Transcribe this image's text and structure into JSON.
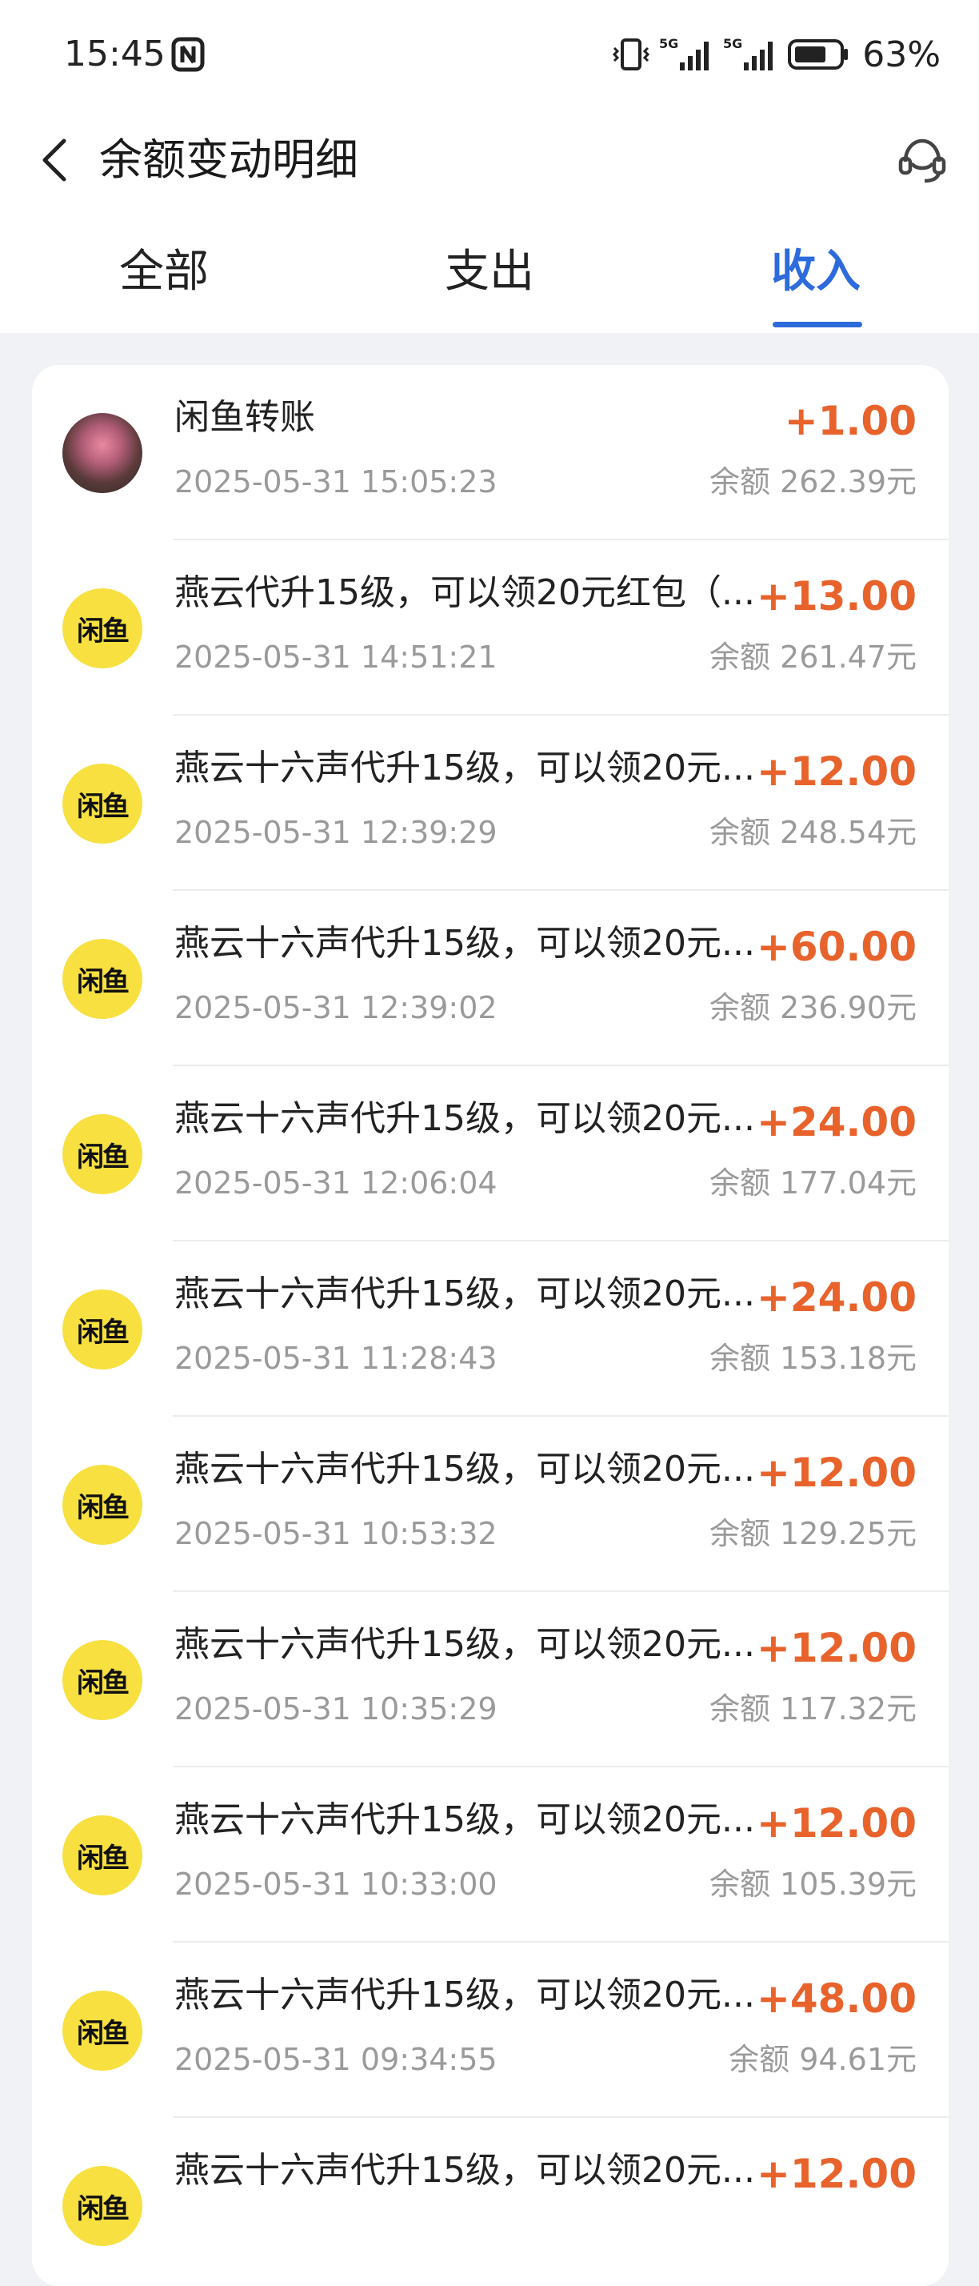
{
  "status": {
    "time": "15:45",
    "signal1": "5G",
    "signal2": "5G",
    "battery": "63%"
  },
  "header": {
    "title": "余额变动明细"
  },
  "tabs": [
    {
      "label": "全部"
    },
    {
      "label": "支出"
    },
    {
      "label": "收入"
    }
  ],
  "active_tab": "收入",
  "colors": {
    "accent": "#2d6bdc",
    "income": "#e8632c",
    "logo_bg": "#f7e040"
  },
  "transactions": [
    {
      "title": "闲鱼转账",
      "time": "2025-05-31 15:05:23",
      "amount": "+1.00",
      "balance": "余额 262.39元",
      "icon": "photo-avatar"
    },
    {
      "title": "燕云代升15级，可以领20元红包（...",
      "time": "2025-05-31 14:51:21",
      "amount": "+13.00",
      "balance": "余额 261.47元",
      "icon": "xianyu-logo",
      "logo": "闲鱼"
    },
    {
      "title": "燕云十六声代升15级，可以领20元...",
      "time": "2025-05-31 12:39:29",
      "amount": "+12.00",
      "balance": "余额 248.54元",
      "icon": "xianyu-logo",
      "logo": "闲鱼"
    },
    {
      "title": "燕云十六声代升15级，可以领20元...",
      "time": "2025-05-31 12:39:02",
      "amount": "+60.00",
      "balance": "余额 236.90元",
      "icon": "xianyu-logo",
      "logo": "闲鱼"
    },
    {
      "title": "燕云十六声代升15级，可以领20元...",
      "time": "2025-05-31 12:06:04",
      "amount": "+24.00",
      "balance": "余额 177.04元",
      "icon": "xianyu-logo",
      "logo": "闲鱼"
    },
    {
      "title": "燕云十六声代升15级，可以领20元...",
      "time": "2025-05-31 11:28:43",
      "amount": "+24.00",
      "balance": "余额 153.18元",
      "icon": "xianyu-logo",
      "logo": "闲鱼"
    },
    {
      "title": "燕云十六声代升15级，可以领20元...",
      "time": "2025-05-31 10:53:32",
      "amount": "+12.00",
      "balance": "余额 129.25元",
      "icon": "xianyu-logo",
      "logo": "闲鱼"
    },
    {
      "title": "燕云十六声代升15级，可以领20元...",
      "time": "2025-05-31 10:35:29",
      "amount": "+12.00",
      "balance": "余额 117.32元",
      "icon": "xianyu-logo",
      "logo": "闲鱼"
    },
    {
      "title": "燕云十六声代升15级，可以领20元...",
      "time": "2025-05-31 10:33:00",
      "amount": "+12.00",
      "balance": "余额 105.39元",
      "icon": "xianyu-logo",
      "logo": "闲鱼"
    },
    {
      "title": "燕云十六声代升15级，可以领20元...",
      "time": "2025-05-31 09:34:55",
      "amount": "+48.00",
      "balance": "余额 94.61元",
      "icon": "xianyu-logo",
      "logo": "闲鱼"
    },
    {
      "title": "燕云十六声代升15级，可以领20元...",
      "time": "",
      "amount": "+12.00",
      "balance": "",
      "icon": "xianyu-logo",
      "logo": "闲鱼"
    }
  ]
}
